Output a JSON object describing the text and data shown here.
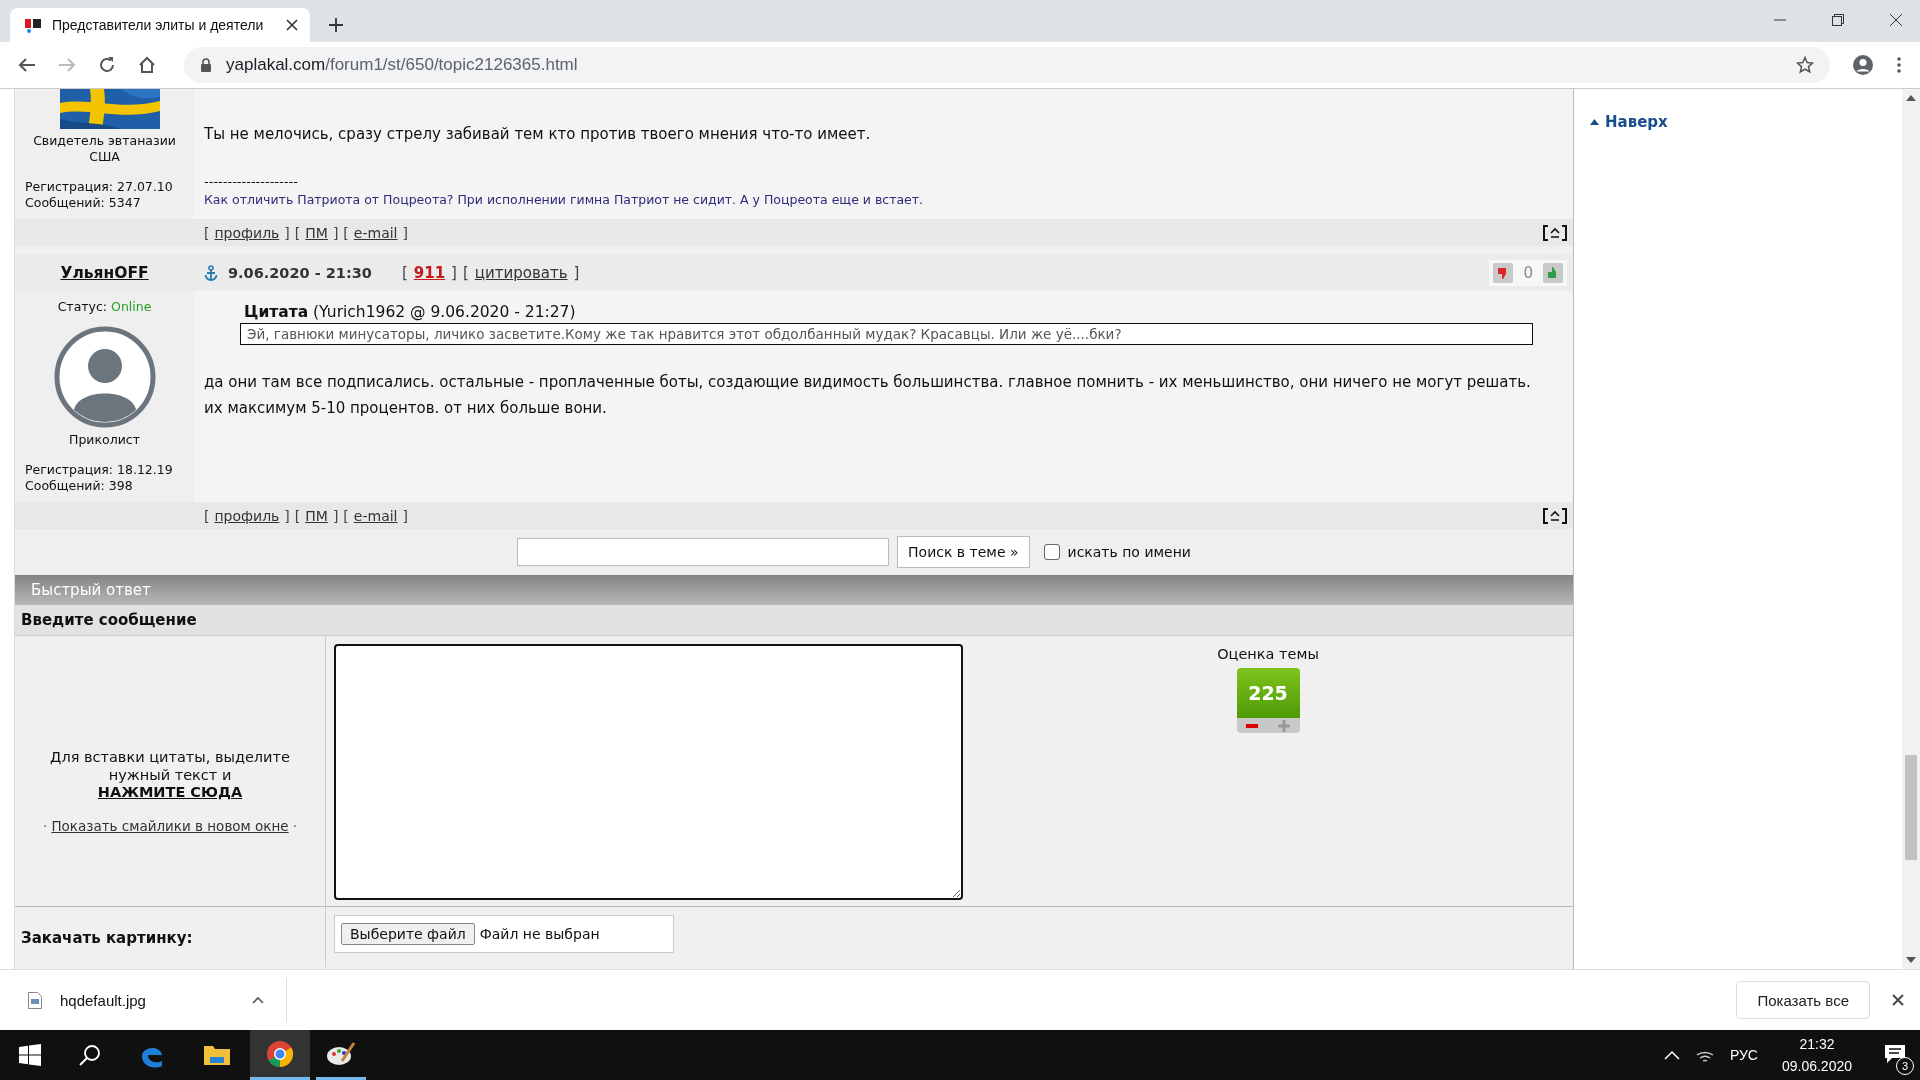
{
  "browser": {
    "tab_title": "Представители элиты и деятели",
    "url_host": "yaplakal.com",
    "url_path": "/forum1/st/650/topic2126365.html"
  },
  "posts": [
    {
      "kind": "partial",
      "author_title": "Свидетель эвтаназии США",
      "registration": "Регистрация: 27.07.10",
      "messages": "Сообщений: 5347",
      "text": "Ты не мелочись, сразу стрелу забивай тем кто против твоего мнения что-то имеет.",
      "signature_rule": "--------------------",
      "signature": "Как отличить Патриота от Поцреота? При исполнении гимна Патриот не сидит. А у Поцреота еще и встает.",
      "links": [
        {
          "open": "[",
          "label": "профиль",
          "close": "]"
        },
        {
          "open": "[",
          "label": "ПМ",
          "close": "]"
        },
        {
          "open": "[",
          "label": "e-mail",
          "close": "]"
        }
      ]
    },
    {
      "kind": "full",
      "author": "УльянOFF",
      "date": "9.06.2020 - 21:30",
      "rating": {
        "open": "[",
        "label": "911",
        "close": "]"
      },
      "quote_link": {
        "open": "[",
        "label": "цитировать",
        "close": "]"
      },
      "votes": "0",
      "status_label": "Статус:",
      "status": "Online",
      "online": true,
      "rank": "Приколист",
      "registration": "Регистрация: 18.12.19",
      "messages": "Сообщений: 398",
      "quote": {
        "title": "Цитата",
        "meta": "(Yurich1962 @ 9.06.2020 - 21:27)",
        "text": "Эй, гавнюки минусаторы, личико засветите.Кому же так нравится этот обдолбанный мудак? Красавцы. Или же уё....бки?"
      },
      "text": "да они там все подписались. остальные - проплаченные боты, создающие видимость большинства. главное помнить - их меньшинство, они ничего не могут решать. их максимум 5-10 процентов. от них больше вони.",
      "links": [
        {
          "open": "[",
          "label": "профиль",
          "close": "]"
        },
        {
          "open": "[",
          "label": "ПМ",
          "close": "]"
        },
        {
          "open": "[",
          "label": "e-mail",
          "close": "]"
        }
      ]
    }
  ],
  "search": {
    "button": "Поиск в теме »",
    "by_name": {
      "label": "искать по имени",
      "checked": false
    }
  },
  "quick_reply": {
    "title": "Быстрый ответ",
    "subtitle": "Введите сообщение",
    "hint": "Для вставки цитаты, выделите нужный текст и",
    "hint_link": "НАЖМИТЕ СЮДА",
    "smileys": {
      "before": "·",
      "label": "Показать смайлики в новом окне",
      "after": "·"
    },
    "rating_title": "Оценка темы",
    "rating_value": "225",
    "upload_label": "Закачать картинку:",
    "file_button": "Выберите файл",
    "file_status": "Файл не выбран"
  },
  "side": {
    "top_link": "Наверх"
  },
  "downloads": {
    "file": "hqdefault.jpg",
    "show_all": "Показать все"
  },
  "taskbar": {
    "language": "РУС",
    "time": "21:32",
    "date": "09.06.2020",
    "notifications": "3"
  }
}
